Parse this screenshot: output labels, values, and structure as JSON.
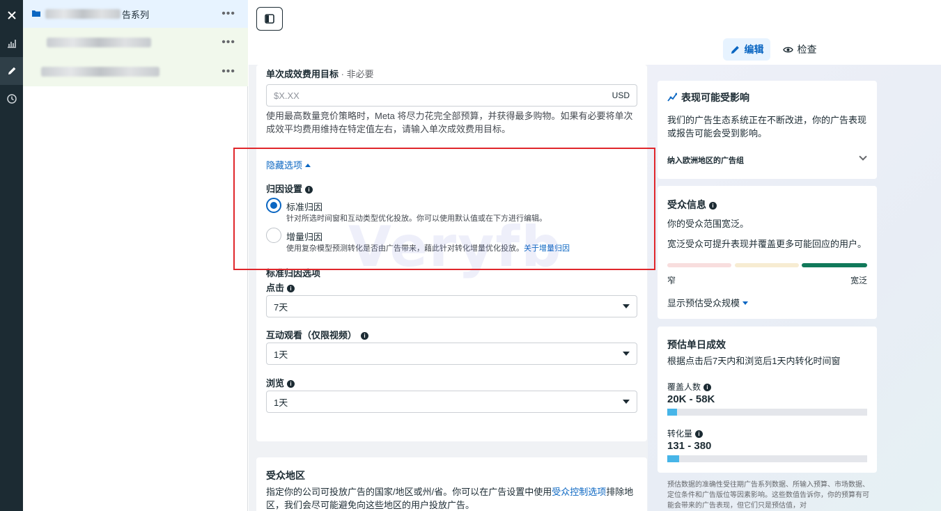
{
  "rail": {
    "icons": [
      "close-icon",
      "bar-chart-icon",
      "pencil-icon",
      "clock-icon"
    ]
  },
  "tree": {
    "items": [
      {
        "label": "告系列",
        "icon": "folder-icon"
      },
      {
        "label": ""
      },
      {
        "label": ""
      }
    ],
    "more": "•••"
  },
  "header": {
    "edit_label": "编辑",
    "review_label": "检查"
  },
  "form": {
    "cost_goal_label": "单次成效费用目标",
    "cost_goal_optional": " · 非必要",
    "cost_goal_placeholder": "$X.XX",
    "currency": "USD",
    "cost_goal_help": "使用最高数量竞价策略时，Meta 将尽力花完全部预算，并获得最多购物。如果有必要将单次成效平均费用维持在特定值左右，请输入单次成效费用目标。",
    "hide_options": "隐藏选项",
    "attribution_label": "归因设置",
    "standard_title": "标准归因",
    "standard_desc": "针对所选时间窗和互动类型优化投放。你可以使用默认值或在下方进行编辑。",
    "incremental_title": "增量归因",
    "incremental_desc": "使用复杂模型预测转化是否由广告带来，藉此针对转化增量优化投放。",
    "incremental_link": "关于增量归因",
    "standard_options_label": "标准归因选项",
    "click_label": "点击",
    "click_value": "7天",
    "engaged_view_label": "互动观看（仅限视频）",
    "engaged_view_value": "1天",
    "view_label": "浏览",
    "view_value": "1天",
    "watermark": "Veryfb"
  },
  "location": {
    "title": "受众地区",
    "text_1": "指定你的公司可投放广告的国家/地区或州/省。你可以在广告设置中使用",
    "link": "受众控制选项",
    "text_2": "排除地区，我们会尽可能避免向这些地区的用户投放广告。"
  },
  "panel_performance": {
    "title": "表现可能受影响",
    "text": "我们的广告生态系统正在不断改进，你的广告表现或报告可能会受到影响。",
    "eu_label": "纳入欧洲地区的广告组"
  },
  "panel_audience": {
    "title": "受众信息",
    "line1": "你的受众范围宽泛。",
    "line2": "宽泛受众可提升表现并覆盖更多可能回应的用户。",
    "narrow": "窄",
    "broad": "宽泛",
    "show_size": "显示预估受众规模",
    "segment_colors": [
      "#f8dede",
      "#f7ecd2",
      "#11795a"
    ],
    "level": "broad"
  },
  "panel_daily": {
    "title": "预估单日成效",
    "subtitle": "根据点击后7天内和浏览后1天内转化时间窗",
    "reach_label": "覆盖人数",
    "reach_value": "20K - 58K",
    "reach_fill": 0.05,
    "conv_label": "转化量",
    "conv_value": "131 - 380",
    "conv_fill": 0.06
  },
  "foot_note": "预估数据的准确性受往期广告系列数据、所输入预算、市场数据、定位条件和广告版位等因素影响。这些数值告诉你，你的预算有可能会带来的广告表现，但它们只是预估值，对"
}
